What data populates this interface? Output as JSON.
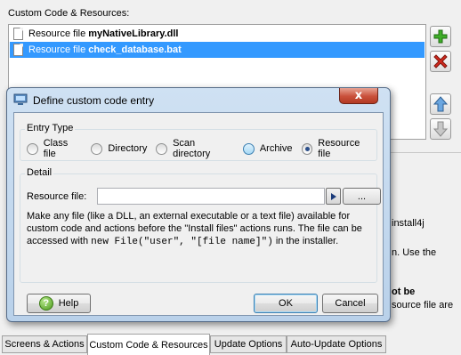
{
  "panel": {
    "section_label": "Custom Code & Resources:",
    "list": [
      {
        "prefix": "Resource file",
        "name": "myNativeLibrary.dll",
        "selected": false
      },
      {
        "prefix": "Resource file",
        "name": "check_database.bat",
        "selected": true
      }
    ],
    "side_buttons": [
      "add-icon",
      "remove-icon",
      "move-up-icon",
      "move-down-icon"
    ],
    "bg_fragments": {
      "f1": "install4j",
      "f2": "n. Use the",
      "f3": "ot be",
      "f4": "source file are"
    }
  },
  "tabs": [
    {
      "label": "Screens & Actions",
      "active": false
    },
    {
      "label": "Custom Code & Resources",
      "active": true
    },
    {
      "label": "Update Options",
      "active": false
    },
    {
      "label": "Auto-Update Options",
      "active": false
    }
  ],
  "dialog": {
    "title": "Define custom code entry",
    "close_symbol": "x",
    "entry_type": {
      "title": "Entry Type",
      "options": [
        {
          "label": "Class file",
          "checked": false
        },
        {
          "label": "Directory",
          "checked": false
        },
        {
          "label": "Scan directory",
          "checked": false
        },
        {
          "label": "Archive",
          "checked": false
        },
        {
          "label": "Resource file",
          "checked": true
        }
      ]
    },
    "detail": {
      "title": "Detail",
      "field_label": "Resource file:",
      "field_value": "",
      "browse_label": "...",
      "desc_part1": "Make any file (like a DLL, an external executable or a text file) available for custom code and actions before the \"Install files\" actions runs. The file can be accessed with ",
      "desc_code": "new File(\"user\", \"[file name]\")",
      "desc_part2": " in the installer."
    },
    "buttons": {
      "help": "Help",
      "ok": "OK",
      "cancel": "Cancel"
    }
  },
  "colors": {
    "selection": "#3399ff",
    "dialog_frame": "#b9d1ea",
    "close_button": "#c9503a"
  }
}
